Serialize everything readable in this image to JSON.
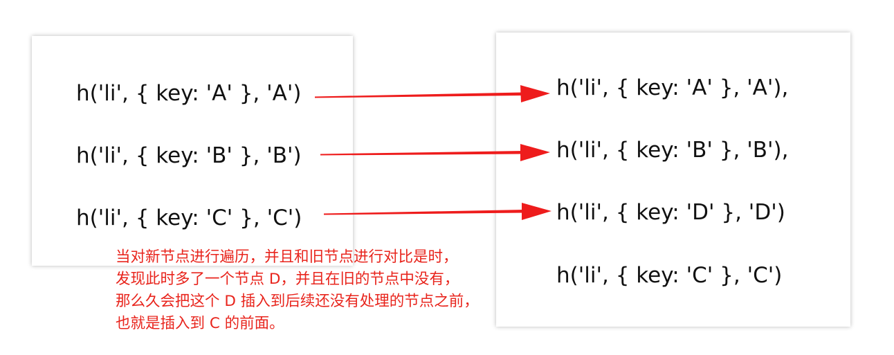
{
  "old_list": [
    "h('li', { key: 'A' }, 'A')",
    "h('li', { key: 'B' }, 'B')",
    "h('li', { key: 'C' }, 'C')"
  ],
  "new_list": [
    "h('li', { key: 'A' }, 'A'),",
    "h('li', { key: 'B' }, 'B'),",
    "h('li', { key: 'D' }, 'D')",
    "h('li', { key: 'C' }, 'C')"
  ],
  "note_lines": [
    "当对新节点进行遍历，并且和旧节点进行对比是时，",
    "发现此时多了一个节点 D，并且在旧的节点中没有，",
    "那么久会把这个 D 插入到后续还没有处理的节点之前，",
    "也就是插入到 C 的前面。"
  ],
  "colors": {
    "arrow": "#ee1c1c",
    "note": "#e8241c"
  }
}
